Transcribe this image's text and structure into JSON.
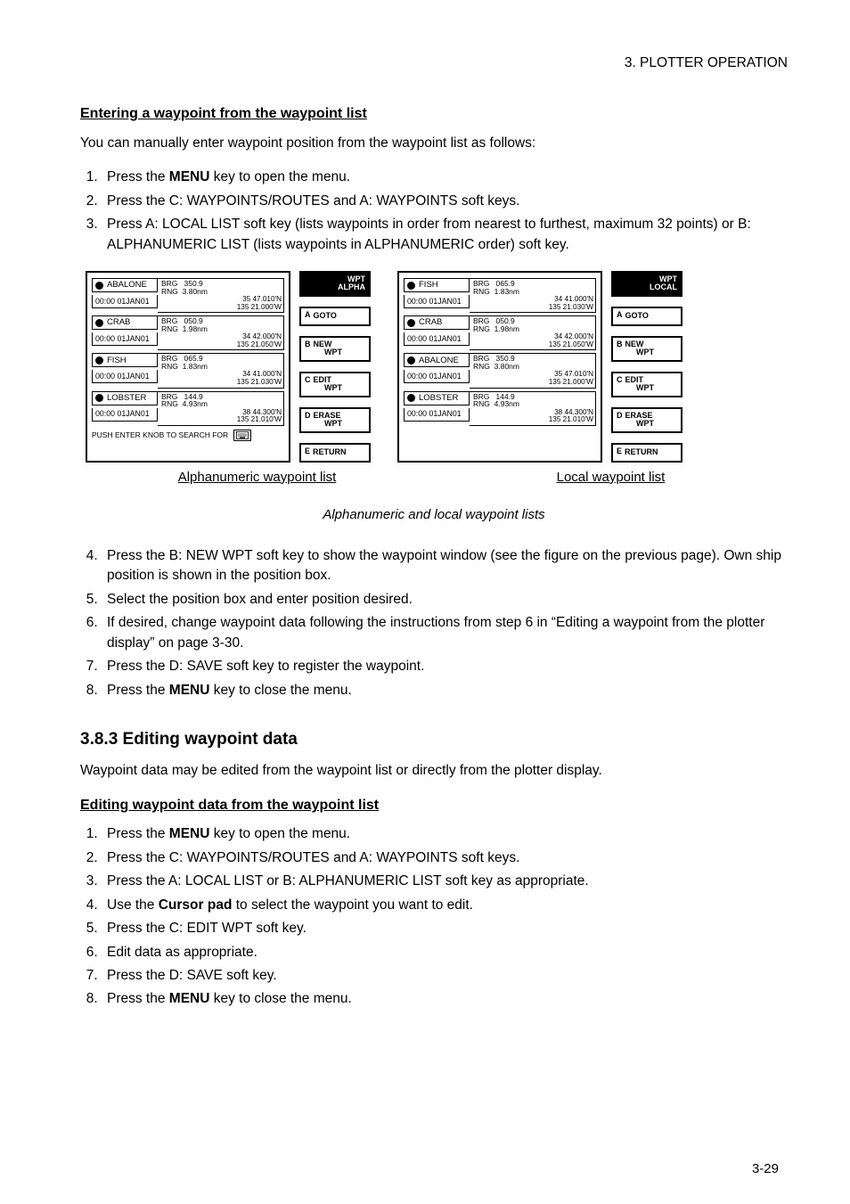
{
  "page_number": "3-29",
  "running_header": "3.  PLOTTER  OPERATION",
  "sections": {
    "s1": {
      "title": "Entering a waypoint from the waypoint list",
      "intro": "You can manually enter waypoint position from the waypoint list as follows:",
      "steps": [
        {
          "pre": "Press the ",
          "key": "MENU",
          "post": " key to open the menu."
        },
        {
          "text": "Press the C: WAYPOINTS/ROUTES and A: WAYPOINTS soft keys."
        },
        {
          "text": "Press A: LOCAL LIST soft key (lists waypoints in order from nearest to furthest, maximum 32 points) or B: ALPHANUMERIC LIST (lists waypoints in ALPHANUMERIC order) soft key."
        }
      ],
      "steps2": [
        "Press the B: NEW WPT soft key to show the waypoint window (see the figure on the previous page). Own ship position is shown in the position box.",
        "Select the position box and enter position desired.",
        "If desired, change waypoint data following the instructions from step 6 in “Editing a waypoint from the plotter display” on page 3-30.",
        "Press the D: SAVE soft key to register the waypoint.",
        {
          "pre": "Press the ",
          "key": "MENU",
          "post": " key to close the menu."
        }
      ]
    },
    "s2": {
      "title": "3.8.3  Editing waypoint data",
      "intro": "Waypoint data may be edited from the waypoint list or directly from the plotter display."
    },
    "s3": {
      "title": "Editing waypoint data from the waypoint list",
      "steps": [
        {
          "pre": "Press the ",
          "key": "MENU",
          "post": " key to open the menu."
        },
        "Press the C: WAYPOINTS/ROUTES and A: WAYPOINTS soft keys.",
        "Press the A: LOCAL LIST or B: ALPHANUMERIC LIST soft key as appropriate.",
        {
          "pre": "Use the ",
          "key": "Cursor pad",
          "post": " to select the waypoint you want to edit."
        },
        "Press the C: EDIT WPT soft key.",
        "Edit data as appropriate.",
        "Press the D: SAVE soft key.",
        {
          "pre": "Press the ",
          "key": "MENU",
          "post": " key to close the menu."
        }
      ]
    }
  },
  "diagram": {
    "caption_alpha": "Alphanumeric waypoint list",
    "caption_local": "Local waypoint list",
    "fig_title": "Alphanumeric and local waypoint lists",
    "alpha": {
      "search_text": "PUSH ENTER KNOB TO SEARCH FOR",
      "rows": [
        {
          "name": "ABALONE",
          "brg_lbl": "BRG",
          "brg": "350.9",
          "rng_lbl": "RNG",
          "rng": "3.80nm",
          "date": "00:00 01JAN01",
          "lat": "35 47.010'N",
          "lon": "135 21.000'W"
        },
        {
          "name": "CRAB",
          "brg_lbl": "BRG",
          "brg": "050.9",
          "rng_lbl": "RNG",
          "rng": "1.98nm",
          "date": "00:00 01JAN01",
          "lat": "34 42.000'N",
          "lon": "135 21.050'W"
        },
        {
          "name": "FISH",
          "brg_lbl": "BRG",
          "brg": "065.9",
          "rng_lbl": "RNG",
          "rng": "1.83nm",
          "date": "00:00 01JAN01",
          "lat": "34 41.000'N",
          "lon": "135 21.030'W"
        },
        {
          "name": "LOBSTER",
          "brg_lbl": "BRG",
          "brg": "144.9",
          "rng_lbl": "RNG",
          "rng": "4.93nm",
          "date": "00:00 01JAN01",
          "lat": "38 44.300'N",
          "lon": "135 21.010'W"
        }
      ]
    },
    "local": {
      "rows": [
        {
          "name": "FISH",
          "brg_lbl": "BRG",
          "brg": "065.9",
          "rng_lbl": "RNG",
          "rng": "1.83nm",
          "date": "00:00 01JAN01",
          "lat": "34 41.000'N",
          "lon": "135 21.030'W"
        },
        {
          "name": "CRAB",
          "brg_lbl": "BRG",
          "brg": "050.9",
          "rng_lbl": "RNG",
          "rng": "1.98nm",
          "date": "00:00 01JAN01",
          "lat": "34 42.000'N",
          "lon": "135 21.050'W"
        },
        {
          "name": "ABALONE",
          "brg_lbl": "BRG",
          "brg": "350.9",
          "rng_lbl": "RNG",
          "rng": "3.80nm",
          "date": "00:00 01JAN01",
          "lat": "35 47.010'N",
          "lon": "135 21.000'W"
        },
        {
          "name": "LOBSTER",
          "brg_lbl": "BRG",
          "brg": "144.9",
          "rng_lbl": "RNG",
          "rng": "4.93nm",
          "date": "00:00 01JAN01",
          "lat": "38 44.300'N",
          "lon": "135 21.010'W"
        }
      ]
    },
    "soft_alpha": {
      "header": {
        "l1": "WPT",
        "l2": "ALPHA"
      },
      "a": {
        "lbl": "A",
        "txt": "GOTO"
      },
      "b": {
        "lbl": "B",
        "l1": "NEW",
        "l2": "WPT"
      },
      "c": {
        "lbl": "C",
        "l1": "EDIT",
        "l2": "WPT"
      },
      "d": {
        "lbl": "D",
        "l1": "ERASE",
        "l2": "WPT"
      },
      "e": {
        "lbl": "E",
        "txt": "RETURN"
      }
    },
    "soft_local": {
      "header": {
        "l1": "WPT",
        "l2": "LOCAL"
      },
      "a": {
        "lbl": "A",
        "txt": "GOTO"
      },
      "b": {
        "lbl": "B",
        "l1": "NEW",
        "l2": "WPT"
      },
      "c": {
        "lbl": "C",
        "l1": "EDIT",
        "l2": "WPT"
      },
      "d": {
        "lbl": "D",
        "l1": "ERASE",
        "l2": "WPT"
      },
      "e": {
        "lbl": "E",
        "txt": "RETURN"
      }
    }
  }
}
